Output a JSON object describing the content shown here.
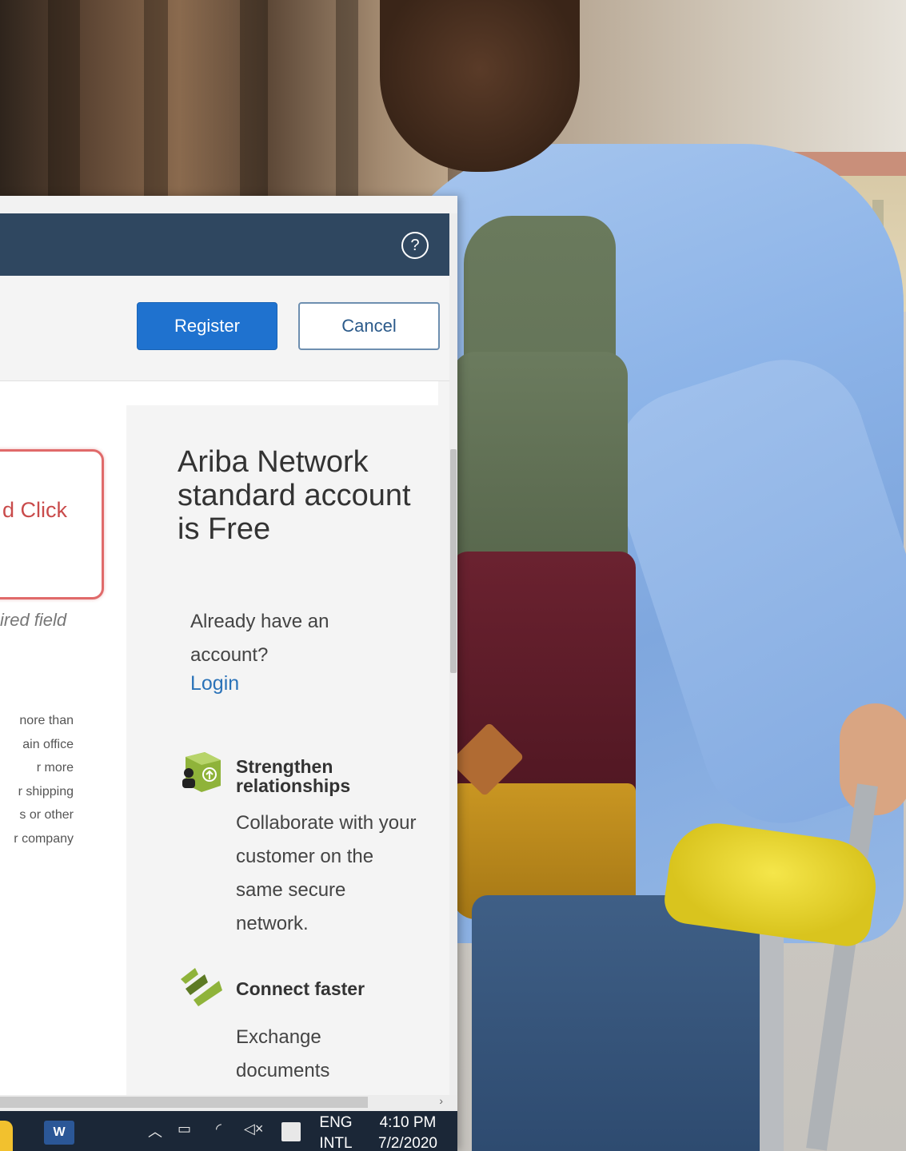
{
  "header": {
    "help_icon": "?"
  },
  "toolbar": {
    "register_label": "Register",
    "cancel_label": "Cancel"
  },
  "form": {
    "callout_text": "d Click",
    "required_note": "ired field",
    "description_lines": [
      "nore than",
      "ain office",
      "r more",
      "r shipping",
      "s or other",
      "r company"
    ]
  },
  "sidebar": {
    "title": "Ariba Network standard account is Free",
    "already_text": "Already have an account?",
    "login_label": "Login",
    "features": [
      {
        "icon": "people-network-icon",
        "title": "Strengthen relationships",
        "description": "Collaborate with your customer on the same secure network."
      },
      {
        "icon": "connect-arrows-icon",
        "title": "Connect faster",
        "description": "Exchange documents"
      }
    ]
  },
  "taskbar": {
    "app_icon_label": "W",
    "tray_icons": [
      "chevron-up-icon",
      "network-icon",
      "wifi-icon",
      "volume-mute-icon",
      "notification-icon"
    ],
    "language_line1": "ENG",
    "language_line2": "INTL",
    "time": "4:10 PM",
    "date": "7/2/2020"
  },
  "colors": {
    "header_bg": "#2f4760",
    "register_bg": "#1f72cf",
    "callout_border": "#e06a6a",
    "link": "#2a72b8",
    "taskbar_bg": "#1b2737"
  }
}
